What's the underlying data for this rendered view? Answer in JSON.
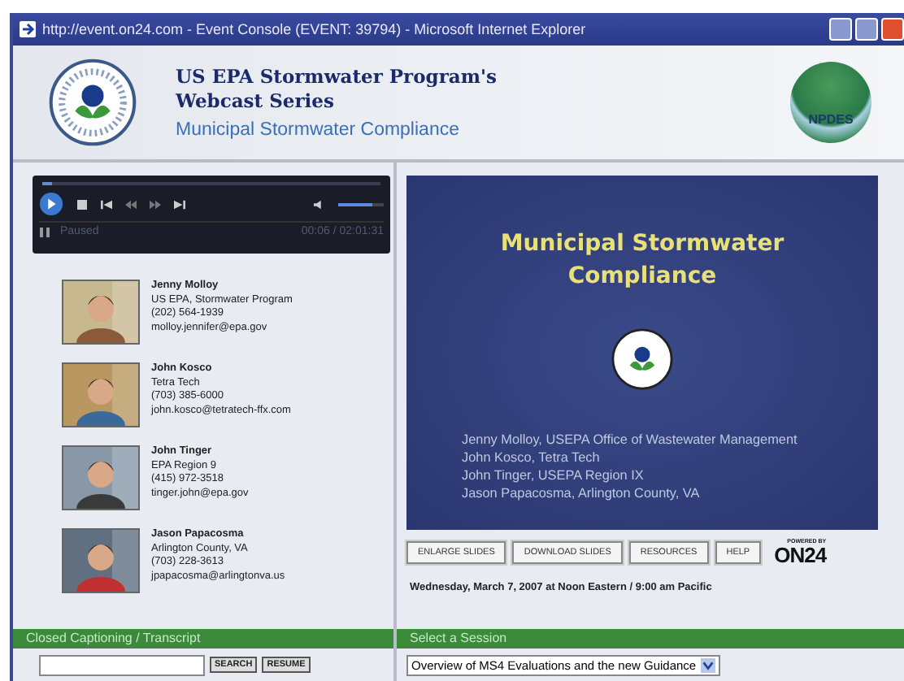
{
  "window": {
    "title": "http://event.on24.com - Event Console (EVENT: 39794) - Microsoft Internet Explorer"
  },
  "header": {
    "title_line_1": "US EPA Stormwater Program's",
    "title_line_2": "Webcast Series",
    "subtitle": "Municipal Stormwater Compliance",
    "badge": "NPDES"
  },
  "player": {
    "status": "Paused",
    "time": "00:06 / 02:01:31",
    "progress": {
      "level": 0.03
    },
    "volume": {
      "level": 0.75
    }
  },
  "speakers": [
    {
      "name": "Jenny Molloy",
      "lines": [
        "US EPA, Stormwater Program",
        "(202) 564-1939",
        "molloy.jennifer@epa.gov"
      ]
    },
    {
      "name": "John Kosco",
      "lines": [
        "Tetra Tech",
        "(703) 385-6000",
        "john.kosco@tetratech-ffx.com"
      ]
    },
    {
      "name": "John Tinger",
      "lines": [
        "EPA Region 9",
        "(415) 972-3518",
        "tinger.john@epa.gov"
      ]
    },
    {
      "name": "Jason Papacosma",
      "lines": [
        "Arlington County, VA",
        "(703) 228-3613",
        "jpapacosma@arlingtonva.us"
      ]
    }
  ],
  "captioning": {
    "title": "Closed Captioning / Transcript",
    "buttons": [
      "SEARCH",
      "RESUME"
    ]
  },
  "slide": {
    "title_line_1": "Municipal Stormwater",
    "title_line_2": "Compliance",
    "presenters": [
      "Jenny Molloy, USEPA Office of Wastewater Management",
      "John Kosco, Tetra Tech",
      "John Tinger, USEPA Region IX",
      "Jason Papacosma, Arlington County, VA"
    ]
  },
  "slide_buttons": [
    "ENLARGE SLIDES",
    "DOWNLOAD SLIDES",
    "RESOURCES",
    "HELP"
  ],
  "powered_by": {
    "label": "POWERED BY",
    "brand": "ON24"
  },
  "date": "Wednesday, March 7, 2007 at Noon Eastern / 9:00 am Pacific",
  "session": {
    "title": "Select a Session",
    "value": "Overview of MS4 Evaluations and the new Guidance"
  }
}
